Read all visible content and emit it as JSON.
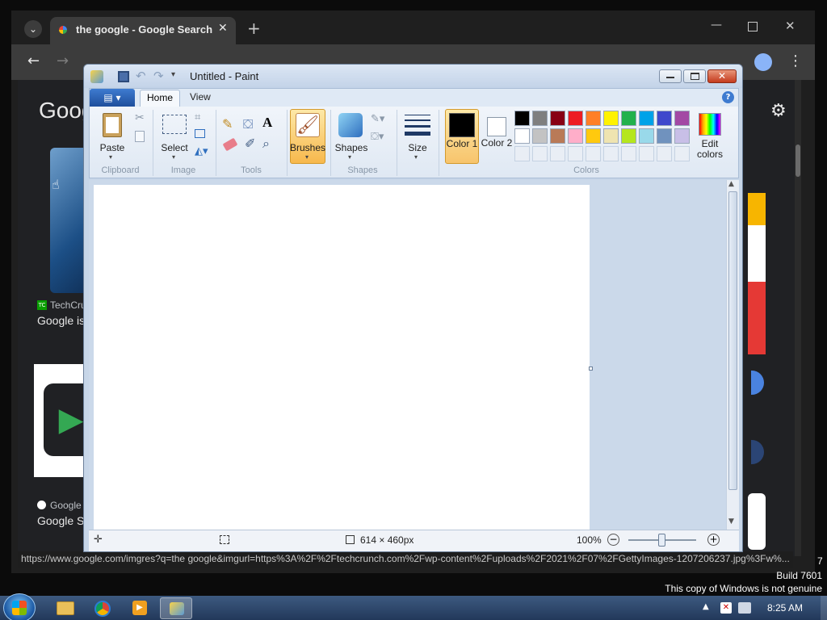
{
  "desktop": {
    "watermark_build": "Build 7601",
    "watermark_genuine": "This copy of Windows is not genuine",
    "edge_digit": "7"
  },
  "chrome": {
    "tab_title": "the google - Google Search",
    "new_tab_symbol": "+",
    "page_logo_partial": "Goog",
    "result1_source": "TechCru",
    "result1_title": "Google is",
    "result2_source": "Google",
    "result2_title": "Google S",
    "status_url": "https://www.google.com/imgres?q=the google&imgurl=https%3A%2F%2Ftechcrunch.com%2Fwp-content%2Fuploads%2F2021%2F07%2FGettyImages-1207206237.jpg%3Fw%..."
  },
  "paint": {
    "title": "Untitled - Paint",
    "tabs": [
      "Home",
      "View"
    ],
    "clipboard": {
      "paste": "Paste",
      "group": "Clipboard"
    },
    "image": {
      "select": "Select",
      "group": "Image"
    },
    "tools": {
      "group": "Tools"
    },
    "brushes": "Brushes",
    "shapes": {
      "label": "Shapes",
      "group": "Shapes"
    },
    "size": "Size",
    "color1": "Color 1",
    "color2": "Color 2",
    "colors_group": "Colors",
    "edit_colors": "Edit colors",
    "palette_row1": [
      "#000000",
      "#7f7f7f",
      "#880015",
      "#ed1c24",
      "#ff7f27",
      "#fff200",
      "#22b14c",
      "#00a2e8",
      "#3f48cc",
      "#a349a4"
    ],
    "palette_row2": [
      "#ffffff",
      "#c3c3c3",
      "#b97a57",
      "#ffaec9",
      "#ffc90e",
      "#efe4b0",
      "#b5e61d",
      "#99d9ea",
      "#7092be",
      "#c8bfe7"
    ],
    "canvas_size": "614 × 460px",
    "zoom": "100%"
  },
  "taskbar": {
    "time": "8:25 AM"
  }
}
